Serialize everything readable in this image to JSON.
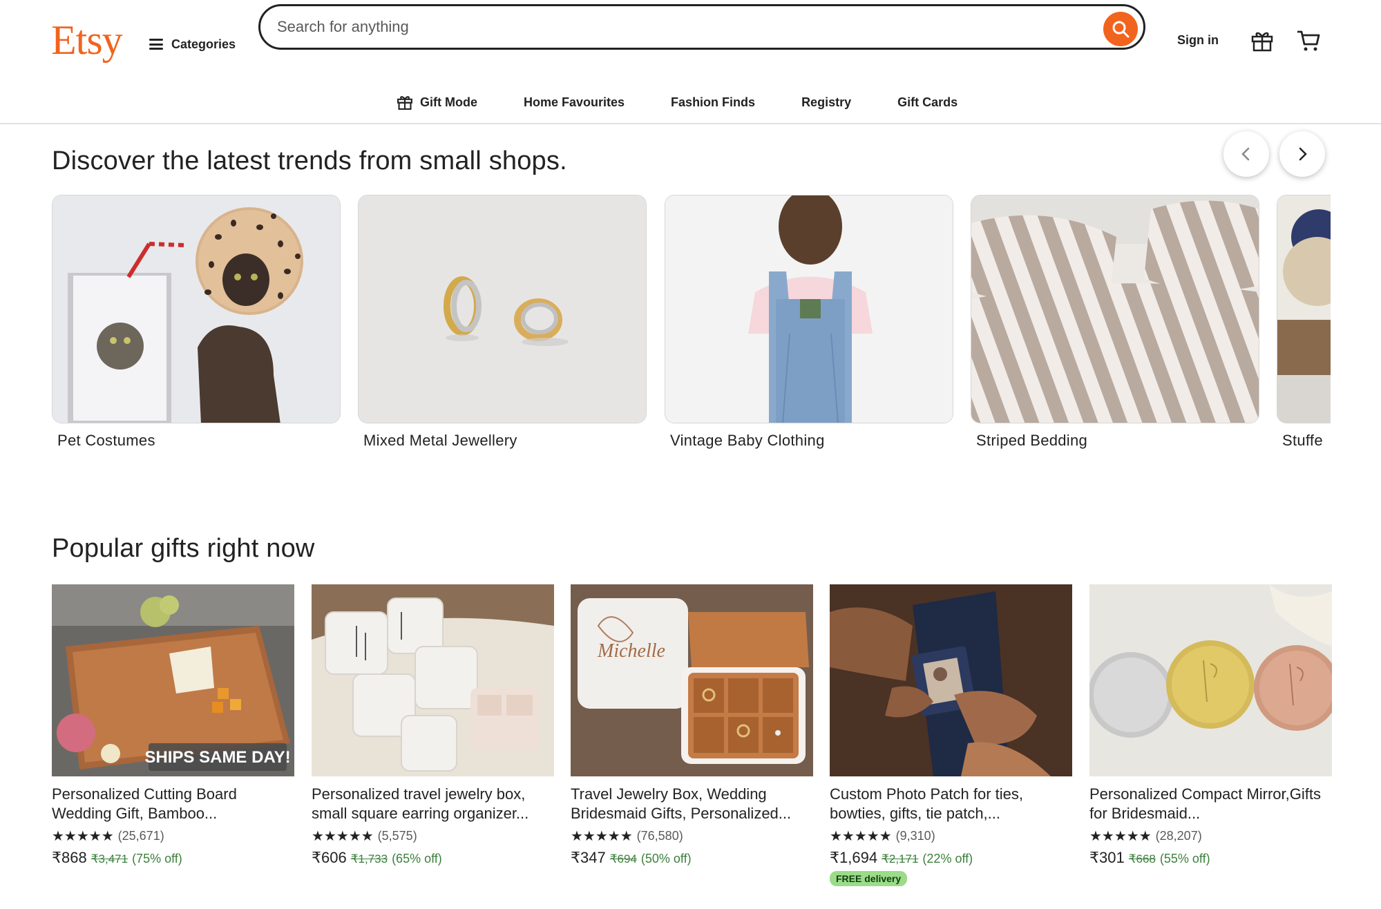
{
  "header": {
    "logo": "Etsy",
    "categories_label": "Categories",
    "search_placeholder": "Search for anything",
    "signin_label": "Sign in"
  },
  "subnav": {
    "items": [
      {
        "label": "Gift Mode",
        "icon": "gift-icon"
      },
      {
        "label": "Home Favourites"
      },
      {
        "label": "Fashion Finds"
      },
      {
        "label": "Registry"
      },
      {
        "label": "Gift Cards"
      }
    ]
  },
  "trends": {
    "title": "Discover the latest trends from small shops.",
    "items": [
      {
        "label": "Pet Costumes"
      },
      {
        "label": "Mixed Metal Jewellery"
      },
      {
        "label": "Vintage Baby Clothing"
      },
      {
        "label": "Striped Bedding"
      },
      {
        "label": "Stuffe"
      }
    ]
  },
  "popular": {
    "title": "Popular gifts right now",
    "items": [
      {
        "title": "Personalized Cutting Board Wedding Gift, Bamboo...",
        "stars": "★★★★★",
        "reviews": "(25,671)",
        "price": "₹868",
        "was": "₹3,471",
        "off": "(75% off)",
        "image_text": "SHIPS SAME DAY!"
      },
      {
        "title": "Personalized travel jewelry box, small square earring organizer...",
        "stars": "★★★★★",
        "reviews": "(5,575)",
        "price": "₹606",
        "was": "₹1,733",
        "off": "(65% off)"
      },
      {
        "title": "Travel Jewelry Box, Wedding Bridesmaid Gifts, Personalized...",
        "stars": "★★★★★",
        "reviews": "(76,580)",
        "price": "₹347",
        "was": "₹694",
        "off": "(50% off)",
        "image_text": "Michelle"
      },
      {
        "title": "Custom Photo Patch for ties, bowties, gifts, tie patch,...",
        "stars": "★★★★★",
        "reviews": "(9,310)",
        "price": "₹1,694",
        "was": "₹2,171",
        "off": "(22% off)",
        "badge": "FREE delivery"
      },
      {
        "title": "Personalized Compact Mirror,Gifts for Bridesmaid...",
        "stars": "★★★★★",
        "reviews": "(28,207)",
        "price": "₹301",
        "was": "₹668",
        "off": "(55% off)"
      }
    ]
  },
  "colors": {
    "brand": "#f1641e",
    "discount": "#3b7f3b",
    "badge": "#9bdb89"
  }
}
